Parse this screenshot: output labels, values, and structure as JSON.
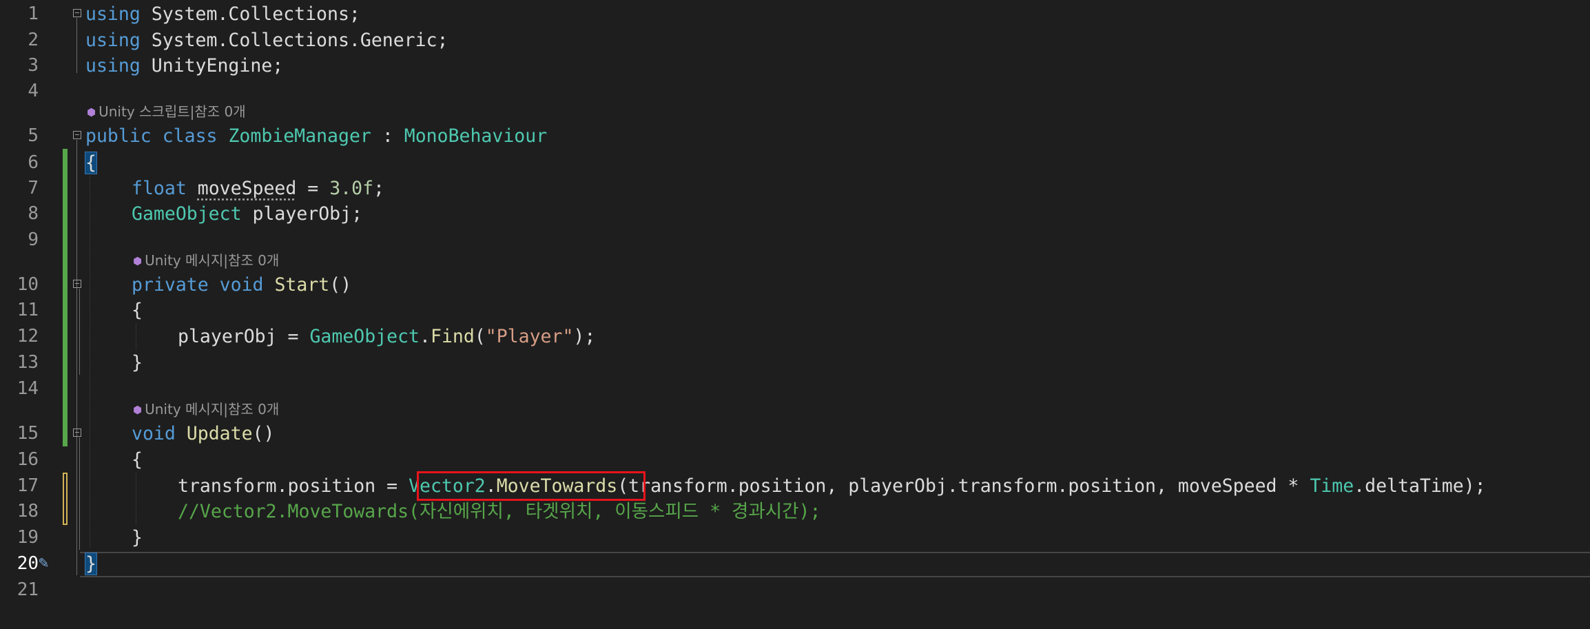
{
  "editor": {
    "line_numbers": [
      "1",
      "2",
      "3",
      "4",
      "5",
      "6",
      "7",
      "8",
      "9",
      "10",
      "11",
      "12",
      "13",
      "14",
      "15",
      "16",
      "17",
      "18",
      "19",
      "20",
      "21"
    ],
    "current_line": "20",
    "codelens": {
      "class_refs": "Unity 스크립트|참조 0개",
      "start_refs": "Unity 메시지|참조 0개",
      "update_refs": "Unity 메시지|참조 0개"
    },
    "tokens": {
      "using": "using",
      "ns_collections": " System.Collections;",
      "ns_generic": " System.Collections.Generic;",
      "ns_unity": " UnityEngine;",
      "public": "public",
      "class": "class",
      "class_name": "ZombieManager",
      "colon": " : ",
      "base_class": "MonoBehaviour",
      "open_brace": "{",
      "close_brace": "}",
      "float": "float",
      "move_speed": "moveSpeed",
      "assign": " = ",
      "speed_value": "3.0f",
      "semicolon": ";",
      "gameobject": "GameObject",
      "player_obj_decl": " playerObj;",
      "private": "private",
      "void": "void",
      "start": "Start",
      "parens": "()",
      "player_obj": "playerObj",
      "dot": ".",
      "find": "Find",
      "open_paren": "(",
      "player_str": "\"Player\"",
      "close_call": ");",
      "update": "Update",
      "transform_position": "transform.position",
      "vector2": "Vector2",
      "move_towards": "MoveTowards",
      "args_part1": "(transform.position, playerObj.transform.position, moveSpeed * ",
      "time": "Time",
      "delta_time": ".deltaTime);",
      "comment": "//Vector2.MoveTowards(자신에위치, 타겟위치, 이동스피드 * 경과시간);"
    }
  },
  "icons": {
    "codelens": "unity-cube-icon",
    "fold": "fold-collapse-icon",
    "gutter_edit": "pencil-icon"
  },
  "colors": {
    "background": "#1e1e1e",
    "keyword": "#569cd6",
    "type": "#4ec9b0",
    "method": "#dcdcaa",
    "string": "#d69d85",
    "number": "#b5cea8",
    "comment": "#57a64a",
    "highlight_box": "#e8141c",
    "change_bar_saved": "#57a64a",
    "change_bar_unsaved": "#d2b356"
  }
}
